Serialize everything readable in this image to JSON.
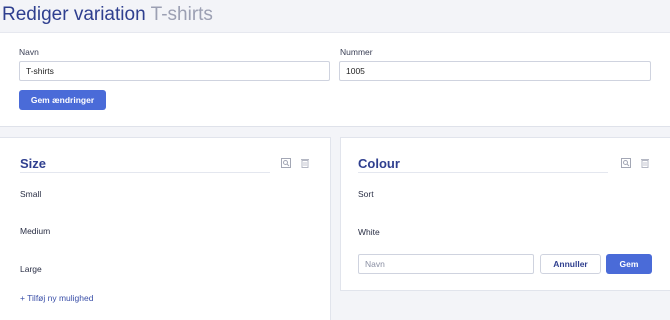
{
  "header": {
    "title": "Rediger variation",
    "subtitle": "T-shirts"
  },
  "form": {
    "name_label": "Navn",
    "name_value": "T-shirts",
    "number_label": "Nummer",
    "number_value": "1005",
    "save_label": "Gem ændringer"
  },
  "attributes": [
    {
      "title": "Size",
      "options": [
        "Small",
        "Medium",
        "Large"
      ],
      "add_option_label": "+ Tilføj ny mulighed",
      "icons": [
        "search-icon",
        "trash-icon"
      ]
    },
    {
      "title": "Colour",
      "options": [
        "Sort",
        "White"
      ],
      "new_option_placeholder": "Navn",
      "cancel_label": "Annuller",
      "save_label": "Gem",
      "icons": [
        "search-icon",
        "trash-icon"
      ]
    }
  ],
  "colors": {
    "accent": "#4a6bd8",
    "heading": "#2f3f8f",
    "background": "#f3f4f8"
  }
}
